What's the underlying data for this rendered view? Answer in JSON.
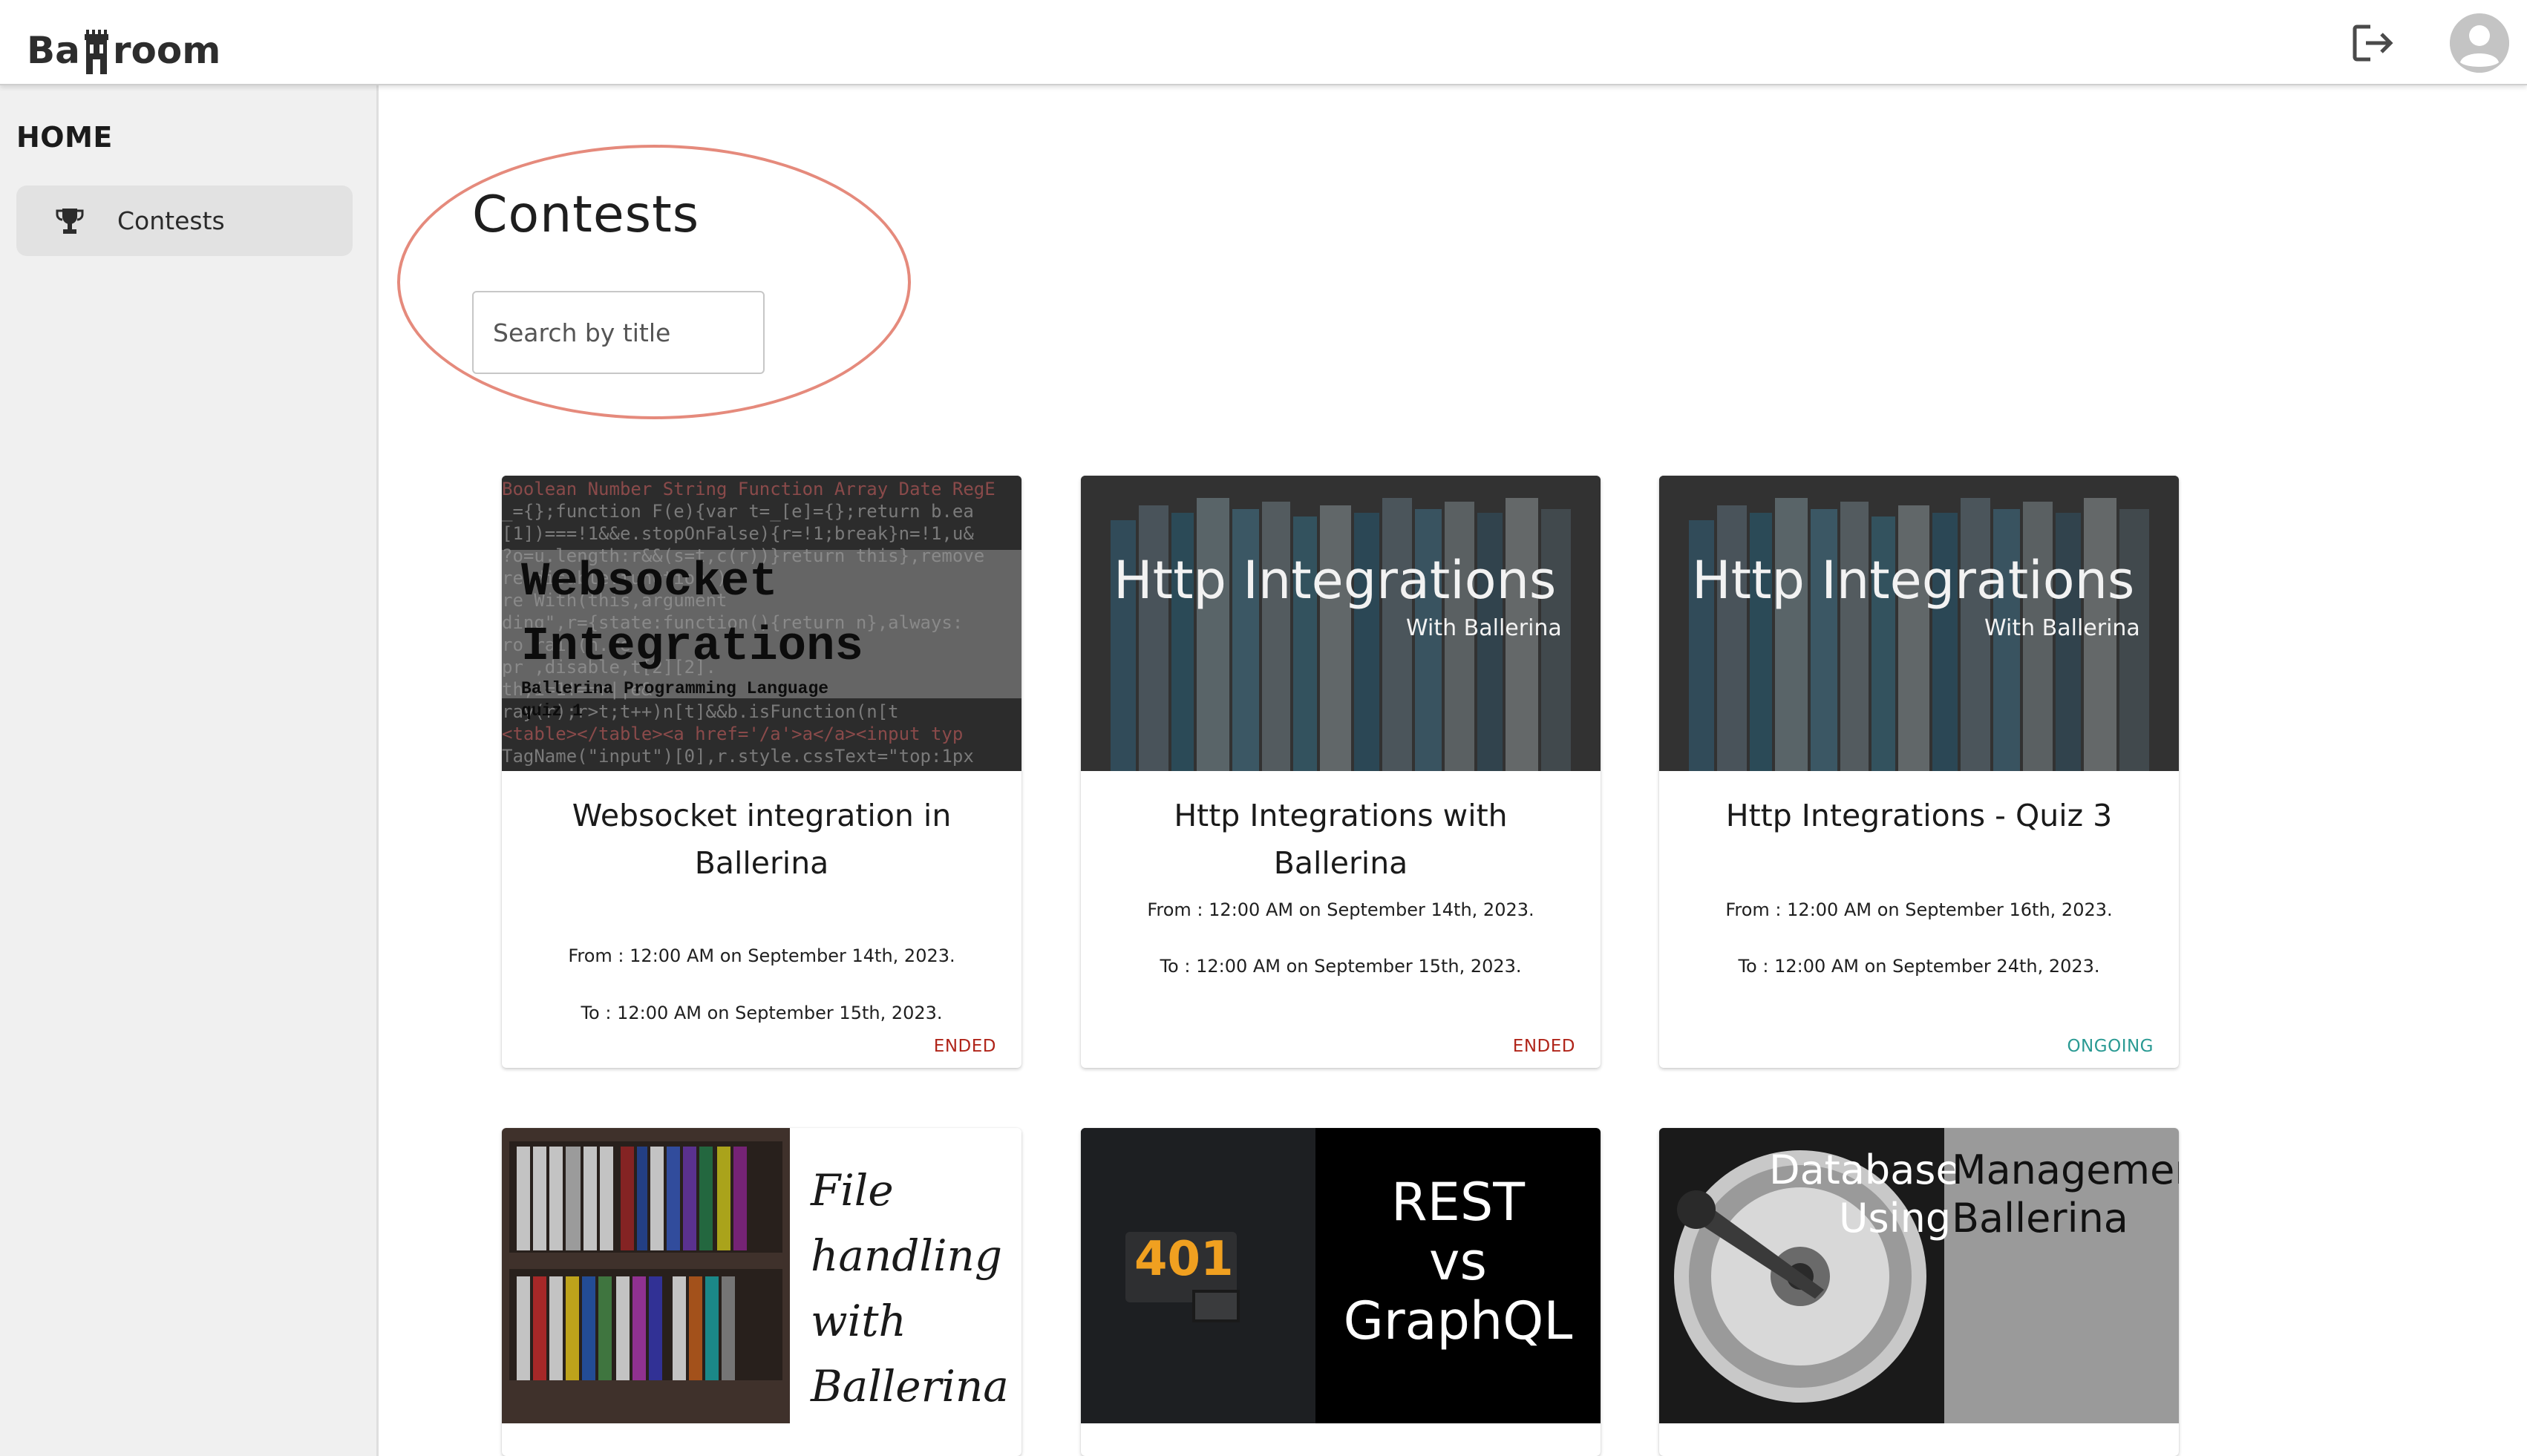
{
  "app": {
    "logo_text_left": "Ba",
    "logo_text_right": "room"
  },
  "header": {
    "logout_icon": "logout-icon",
    "avatar_icon": "account-circle-icon"
  },
  "sidebar": {
    "heading": "HOME",
    "items": [
      {
        "label": "Contests",
        "icon": "trophy-icon"
      }
    ]
  },
  "main": {
    "title": "Contests",
    "search": {
      "placeholder": "Search by title",
      "value": ""
    },
    "cards": [
      {
        "title": "Websocket integration in Ballerina",
        "from": "From : 12:00 AM on September 14th, 2023.",
        "to": "To : 12:00 AM on September 15th, 2023.",
        "status": "ENDED",
        "image": {
          "heading_1": "Websocket",
          "heading_2": "Integrations",
          "sub_1": "Ballerina Programming Language",
          "sub_2": "quiz 1"
        }
      },
      {
        "title": "Http Integrations with Ballerina",
        "from": "From : 12:00 AM on September 14th, 2023.",
        "to": "To : 12:00 AM on September 15th, 2023.",
        "status": "ENDED",
        "image": {
          "heading": "Http Integrations",
          "sub": "With Ballerina"
        }
      },
      {
        "title": "Http Integrations - Quiz 3",
        "from": "From : 12:00 AM on September 16th, 2023.",
        "to": "To : 12:00 AM on September 24th, 2023.",
        "status": "ONGOING",
        "image": {
          "heading": "Http Integrations",
          "sub": "With Ballerina"
        }
      },
      {
        "image": {
          "lines": [
            "File",
            "handling",
            "with",
            "Ballerina"
          ]
        }
      },
      {
        "image": {
          "badge": "401",
          "lines": [
            "REST",
            "vs",
            "GraphQL"
          ]
        }
      },
      {
        "image": {
          "line_1a": "Database",
          "line_1b": "Management",
          "line_2a": "Using",
          "line_2b": "Ballerina"
        }
      }
    ]
  },
  "colors": {
    "ended": "#b0251a",
    "ongoing": "#2a9a93",
    "highlight": "#e58a7c"
  }
}
